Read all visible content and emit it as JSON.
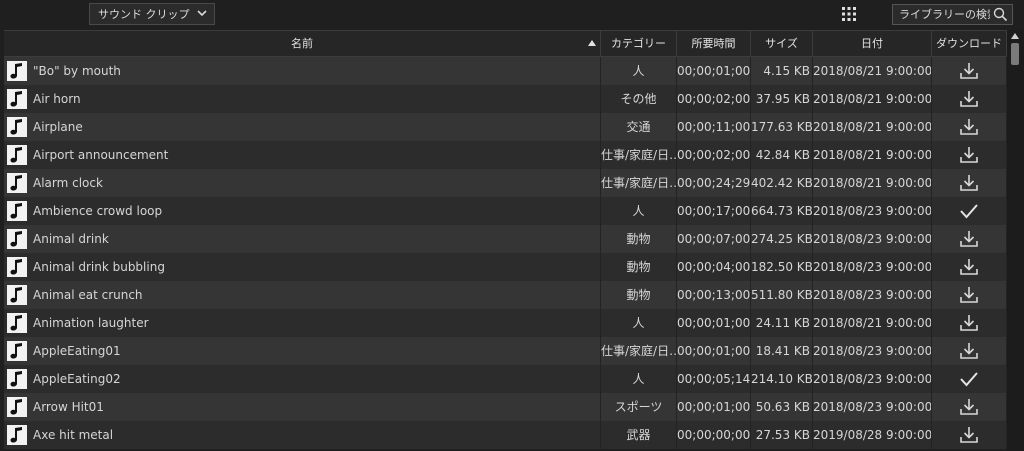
{
  "toolbar": {
    "category_dropdown": "サウンド クリップ",
    "search_placeholder": "ライブラリーの検索"
  },
  "table": {
    "columns": {
      "name": "名前",
      "category": "カテゴリー",
      "duration": "所要時間",
      "size": "サイズ",
      "date": "日付",
      "download": "ダウンロード"
    },
    "rows": [
      {
        "name": "\"Bo\" by mouth",
        "category": "人",
        "duration": "00;00;01;00",
        "size": "4.15 KB",
        "date": "2018/08/21 9:00:00",
        "status": "download"
      },
      {
        "name": "Air horn",
        "category": "その他",
        "duration": "00;00;02;00",
        "size": "37.95 KB",
        "date": "2018/08/21 9:00:00",
        "status": "download"
      },
      {
        "name": "Airplane",
        "category": "交通",
        "duration": "00;00;11;00",
        "size": "177.63 KB",
        "date": "2018/08/21 9:00:00",
        "status": "download"
      },
      {
        "name": "Airport announcement",
        "category": "仕事/家庭/日…",
        "duration": "00;00;02;00",
        "size": "42.84 KB",
        "date": "2018/08/21 9:00:00",
        "status": "download"
      },
      {
        "name": "Alarm clock",
        "category": "仕事/家庭/日…",
        "duration": "00;00;24;29",
        "size": "402.42 KB",
        "date": "2018/08/21 9:00:00",
        "status": "download"
      },
      {
        "name": "Ambience crowd loop",
        "category": "人",
        "duration": "00;00;17;00",
        "size": "664.73 KB",
        "date": "2018/08/23 9:00:00",
        "status": "downloaded"
      },
      {
        "name": "Animal drink",
        "category": "動物",
        "duration": "00;00;07;00",
        "size": "274.25 KB",
        "date": "2018/08/23 9:00:00",
        "status": "download"
      },
      {
        "name": "Animal drink bubbling",
        "category": "動物",
        "duration": "00;00;04;00",
        "size": "182.50 KB",
        "date": "2018/08/23 9:00:00",
        "status": "download"
      },
      {
        "name": "Animal eat crunch",
        "category": "動物",
        "duration": "00;00;13;00",
        "size": "511.80 KB",
        "date": "2018/08/23 9:00:00",
        "status": "download"
      },
      {
        "name": "Animation laughter",
        "category": "人",
        "duration": "00;00;01;00",
        "size": "24.11 KB",
        "date": "2018/08/21 9:00:00",
        "status": "download"
      },
      {
        "name": "AppleEating01",
        "category": "仕事/家庭/日…",
        "duration": "00;00;01;00",
        "size": "18.41 KB",
        "date": "2018/08/23 9:00:00",
        "status": "download"
      },
      {
        "name": "AppleEating02",
        "category": "人",
        "duration": "00;00;05;14",
        "size": "214.10 KB",
        "date": "2018/08/23 9:00:00",
        "status": "downloaded"
      },
      {
        "name": "Arrow Hit01",
        "category": "スポーツ",
        "duration": "00;00;01;00",
        "size": "50.63 KB",
        "date": "2018/08/23 9:00:00",
        "status": "download"
      },
      {
        "name": "Axe hit metal",
        "category": "武器",
        "duration": "00;00;00;00",
        "size": "27.53 KB",
        "date": "2019/08/28 9:00:00",
        "status": "download"
      }
    ]
  },
  "icons": {
    "row_icon": "music-note-icon",
    "download": "download-icon",
    "downloaded": "checkmark-icon",
    "view_toggle": "grid-dots-icon",
    "search": "search-icon"
  }
}
